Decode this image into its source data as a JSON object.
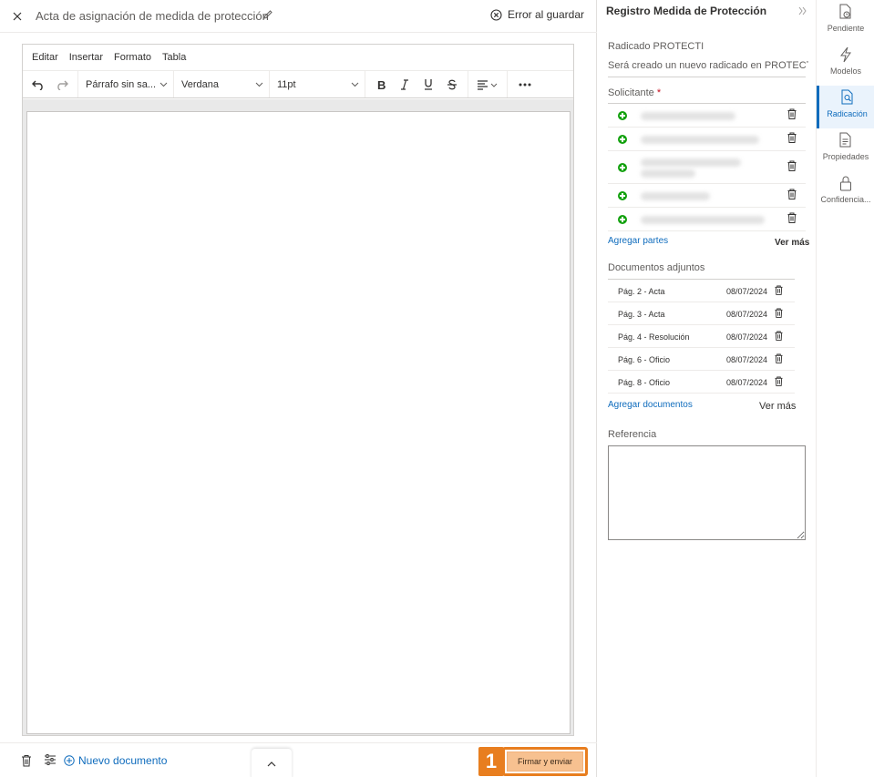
{
  "document": {
    "title": "Acta de asignación de medida de protección",
    "save_status": "Error al guardar"
  },
  "editor": {
    "menu": [
      "Editar",
      "Insertar",
      "Formato",
      "Tabla"
    ],
    "paragraph_style": "Párrafo sin sa...",
    "font_family": "Verdana",
    "font_size": "11pt"
  },
  "footer": {
    "new_document": "Nuevo documento",
    "sign_button": "Firmar y enviar",
    "step_marker": "1"
  },
  "panel": {
    "title": "Registro Medida de Protección",
    "radicado_label": "Radicado PROTECTI",
    "radicado_value": "Será creado un nuevo radicado en PROTECTI",
    "solicitante_label": "Solicitante",
    "required_mark": "*",
    "add_parties": "Agregar partes",
    "see_more_parties": "Ver más",
    "attachments_label": "Documentos adjuntos",
    "attachments": [
      {
        "name": "Pág. 2 - Acta",
        "date": "08/07/2024"
      },
      {
        "name": "Pág. 3 - Acta",
        "date": "08/07/2024"
      },
      {
        "name": "Pág. 4 - Resolución",
        "date": "08/07/2024"
      },
      {
        "name": "Pág. 6 - Oficio",
        "date": "08/07/2024"
      },
      {
        "name": "Pág. 8 - Oficio",
        "date": "08/07/2024"
      }
    ],
    "add_documents": "Agregar documentos",
    "see_more_documents": "Ver más",
    "reference_label": "Referencia",
    "reference_value": ""
  },
  "rail": {
    "items": [
      "Pendiente",
      "Modelos",
      "Radicación",
      "Propiedades",
      "Confidencia..."
    ],
    "active": "Radicación"
  },
  "colors": {
    "accent": "#0f6cbd",
    "highlight": "#e87e1f",
    "sign_button_bg": "#f7c190",
    "add_party_green": "#13a10e"
  }
}
